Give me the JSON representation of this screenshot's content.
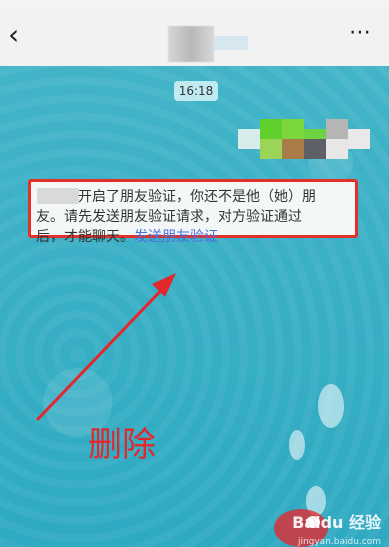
{
  "time_label": "16:18",
  "system_message": {
    "prefix": "开启了朋友验证，你还不是他（她）朋",
    "line2": "友。请先发送朋友验证请求，对方验证通过",
    "line3": "后，才能聊天。",
    "link": "发送朋友验证"
  },
  "annotation_label": "删除",
  "watermark": {
    "brand": "Bai",
    "suffix": "经验",
    "url": "jingyan.baidu.com"
  },
  "colors": {
    "accent_red": "#e1312a",
    "chat_bg": "#35b1c8",
    "link_blue": "#4a6fd9"
  },
  "icons": {
    "back": "chevron-left-icon",
    "more": "more-dots-icon"
  }
}
